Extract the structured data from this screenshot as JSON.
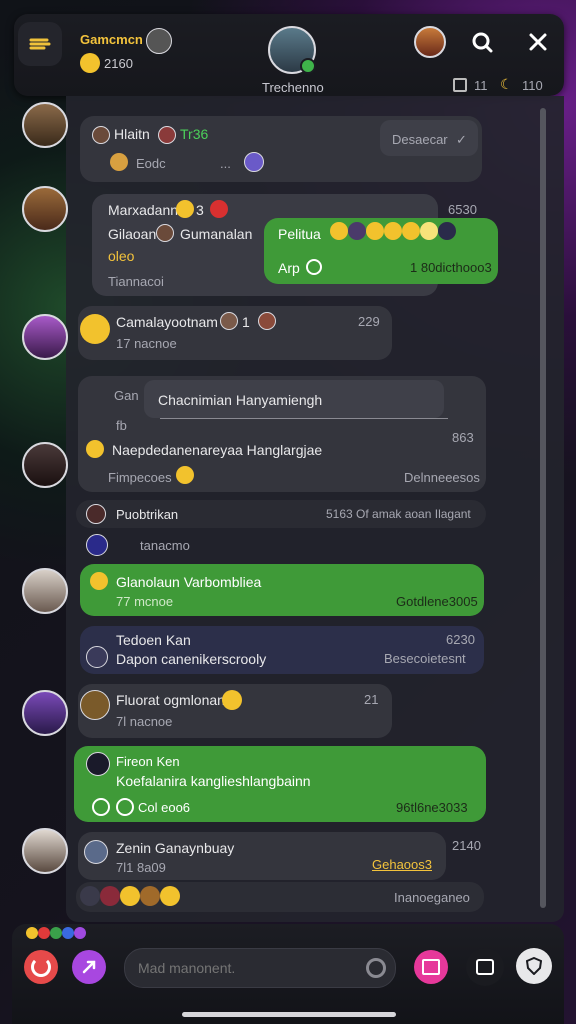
{
  "header": {
    "username": "Gamcmcn",
    "status_value": "2160",
    "center_label": "Trechenno",
    "stat_left": "11",
    "stat_right": "110"
  },
  "messages": [
    {
      "name": "Hlaitn",
      "tag": "Tr36",
      "line": "Eodc",
      "right": "Desaecar"
    },
    {
      "name": "Marxadann",
      "badge": "3",
      "line1": "Gilaoan",
      "line1b": "Gumanalan",
      "line2": "oleo",
      "line3": "Tiannacoi",
      "time": "6530"
    },
    {
      "name": "Pelitua",
      "sub": "Arp",
      "code": "1 80dicthooo3"
    },
    {
      "name": "Camalayootnam",
      "badge": "1",
      "value": "229",
      "sub": "17 nacnoe"
    },
    {
      "prefix": "Gan",
      "quote": "Chacnimian Hanyamiengh",
      "n": "fb",
      "line": "Naepdedanenareyaa Hanglargjae",
      "time": "863",
      "sub": "Fimpecoes",
      "right": "Delnneeesos"
    },
    {
      "name": "Puobtrikan",
      "right": "5163 Of amak aoan Ilagant",
      "sub": "tanacmo"
    },
    {
      "name": "Glanolaun Varbombliea",
      "sub": "77 mcnoe",
      "right": "Gotdlene3005"
    },
    {
      "name": "Tedoen Kan",
      "time": "6230",
      "line": "Dapon canenikerscrooly",
      "right": "Besecoietesnt"
    },
    {
      "name": "Fluorat ogmlonan",
      "value": "21",
      "sub": "7l nacnoe"
    },
    {
      "name": "Fireon Ken",
      "line": "Koefalanira kanglieshlangbainn",
      "sub": "Col eoo6",
      "right": "96tl6ne3033"
    },
    {
      "name": "Zenin Ganaynbuay",
      "time": "2140",
      "sub": "7l1 8a09",
      "right": "Gehaoos3"
    },
    {
      "right": "Inanoeganeo"
    }
  ],
  "composer": {
    "placeholder": "Mad manonent."
  },
  "colors": {
    "green": "#3f9a38",
    "panel": "#23242c",
    "accent_pink": "#e6389a",
    "accent_violet": "#a847e0"
  }
}
